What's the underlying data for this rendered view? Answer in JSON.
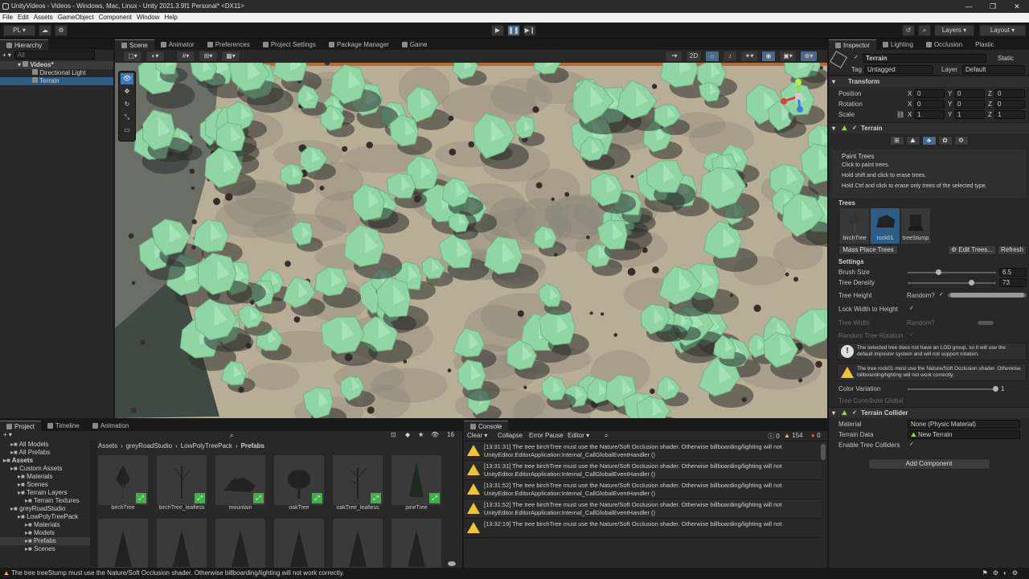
{
  "window": {
    "title": "UnityVideos - Videos - Windows, Mac, Linux - Unity 2021.3.9f1 Personal* <DX11>",
    "controls": [
      "—",
      "❐",
      "✕"
    ]
  },
  "menu": [
    "File",
    "Edit",
    "Assets",
    "GameObject",
    "Component",
    "Window",
    "Help"
  ],
  "toolbar": {
    "account": "PL",
    "layers": "Layers",
    "layout": "Layout"
  },
  "hierarchy": {
    "tab": "Hierarchy",
    "search_placeholder": "All",
    "scene": "Videos*",
    "items": [
      "Directional Light",
      "Terrain"
    ]
  },
  "scene_tabs": [
    "Scene",
    "Animator",
    "Preferences",
    "Project Settings",
    "Package Manager",
    "Game"
  ],
  "scene_toolbar": {
    "mode_2d": "2D"
  },
  "inspector": {
    "tabs": [
      "Inspector",
      "Lighting",
      "Occlusion",
      "Plastic"
    ],
    "object_name": "Terrain",
    "static_label": "Static",
    "tag_label": "Tag",
    "tag_value": "Untagged",
    "layer_label": "Layer",
    "layer_value": "Default",
    "transform": {
      "title": "Transform",
      "rows": [
        {
          "label": "Position",
          "x": "0",
          "y": "0",
          "z": "0"
        },
        {
          "label": "Rotation",
          "x": "0",
          "y": "0",
          "z": "0"
        },
        {
          "label": "Scale",
          "x": "1",
          "y": "1",
          "z": "1"
        }
      ]
    },
    "terrain": {
      "title": "Terrain",
      "mode_title": "Paint Trees",
      "help": [
        "Click to paint trees.",
        "Hold shift and click to erase trees.",
        "Hold Ctrl and click to erase only trees of the selected type."
      ],
      "trees_header": "Trees",
      "tree_prototypes": [
        "birchTree",
        "rock01",
        "treeStump"
      ],
      "mass_place": "Mass Place Trees",
      "edit_trees": "Edit Trees...",
      "refresh": "Refresh",
      "settings_header": "Settings",
      "brush_size_label": "Brush Size",
      "brush_size": "6.5",
      "brush_size_fraction": 0.35,
      "tree_density_label": "Tree Density",
      "tree_density": "73",
      "tree_density_fraction": 0.73,
      "tree_height_label": "Tree Height",
      "random_label": "Random?",
      "lock_width_label": "Lock Width to Height",
      "tree_width_label": "Tree Width",
      "random_rotation_label": "Random Tree Rotation",
      "info_msg": "The selected tree does not have an LOD group, so it will use the default impostor system and will not support rotation.",
      "warn_msg": "The tree rock01 must use the Nature/Soft Occlusion shader. Otherwise billboarding/lighting will not work correctly.",
      "color_variation_label": "Color Variation",
      "color_variation": "1",
      "color_variation_fraction": 1.0,
      "contribute_gi_label": "Tree Contribute Global"
    },
    "collider": {
      "title": "Terrain Collider",
      "material_label": "Material",
      "material_value": "None (Physic Material)",
      "data_label": "Terrain Data",
      "data_value": "New Terrain",
      "enable_trees_label": "Enable Tree Colliders"
    },
    "add_component": "Add Component"
  },
  "project": {
    "tabs": [
      "Project",
      "Timeline",
      "Animation"
    ],
    "hidden_count": "16",
    "breadcrumb": [
      "Assets",
      "greyRoadStudio",
      "LowPolyTreePack",
      "Prefabs"
    ],
    "tree": [
      {
        "label": "All Models",
        "indent": 1
      },
      {
        "label": "All Prefabs",
        "indent": 1
      },
      {
        "label": "Assets",
        "indent": 0
      },
      {
        "label": "Custom Assets",
        "indent": 1
      },
      {
        "label": "Materials",
        "indent": 2
      },
      {
        "label": "Scenes",
        "indent": 2
      },
      {
        "label": "Terrain Layers",
        "indent": 2
      },
      {
        "label": "Terrain Textures",
        "indent": 3
      },
      {
        "label": "greyRoadStudio",
        "indent": 1
      },
      {
        "label": "LowPolyTreePack",
        "indent": 2
      },
      {
        "label": "Materials",
        "indent": 3
      },
      {
        "label": "Models",
        "indent": 3
      },
      {
        "label": "Prefabs",
        "indent": 3
      },
      {
        "label": "Scenes",
        "indent": 3
      }
    ],
    "assets": [
      "birchTree",
      "birchTree_leafless",
      "mountain",
      "oakTree",
      "oakTree_leafless",
      "pineTree"
    ]
  },
  "console": {
    "tab": "Console",
    "buttons": [
      "Clear",
      "Collapse",
      "Error Pause",
      "Editor"
    ],
    "counts": {
      "info": "0",
      "warn": "154",
      "error": "0"
    },
    "logs": [
      {
        "line1": "[13:31:31] The tree birchTree must use the Nature/Soft Occlusion shader. Otherwise billboarding/lighting will not",
        "line2": "UnityEditor.EditorApplication:Internal_CallGlobalEventHandler ()"
      },
      {
        "line1": "[13:31:31] The tree birchTree must use the Nature/Soft Occlusion shader. Otherwise billboarding/lighting will not",
        "line2": "UnityEditor.EditorApplication:Internal_CallGlobalEventHandler ()"
      },
      {
        "line1": "[13:31:52] The tree birchTree must use the Nature/Soft Occlusion shader. Otherwise billboarding/lighting will not",
        "line2": "UnityEditor.EditorApplication:Internal_CallGlobalEventHandler ()"
      },
      {
        "line1": "[13:31:52] The tree birchTree must use the Nature/Soft Occlusion shader. Otherwise billboarding/lighting will not",
        "line2": "UnityEditor.EditorApplication:Internal_CallGlobalEventHandler ()"
      },
      {
        "line1": "[13:32:19] The tree birchTree must use the Nature/Soft Occlusion shader. Otherwise billboarding/lighting will not",
        "line2": ""
      }
    ]
  },
  "statusbar": "The tree treeStump must use the Nature/Soft Occlusion shader. Otherwise billboarding/lighting will not work correctly.",
  "colors": {
    "accent": "#3a79bb",
    "warning": "#f1c232",
    "ground": "#b8ad95",
    "foliage": "#8fd6a4"
  }
}
